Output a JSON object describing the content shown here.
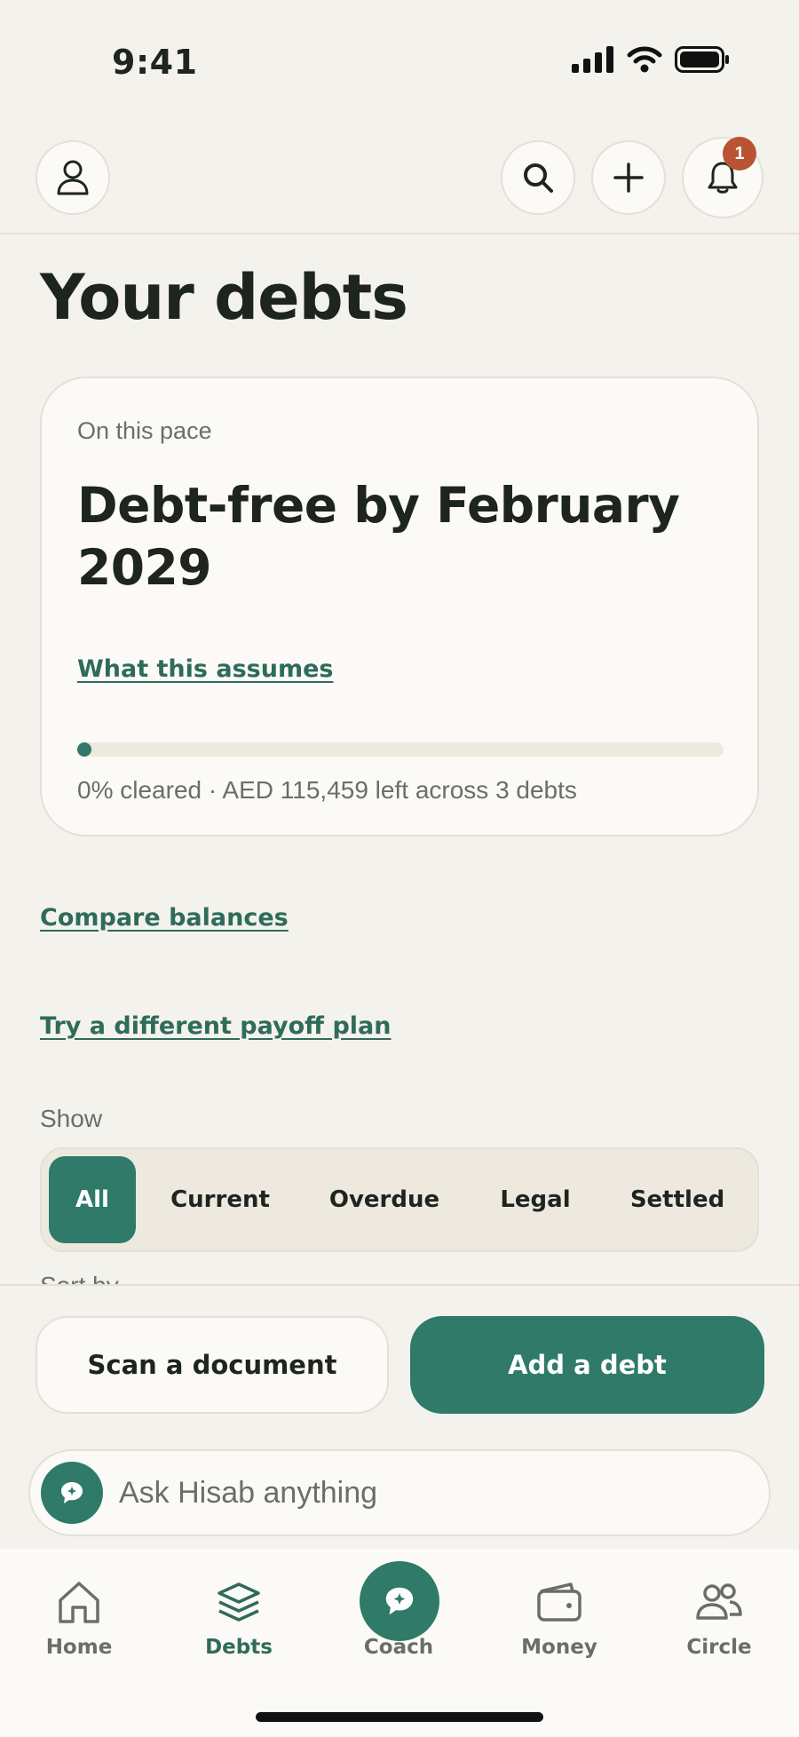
{
  "status": {
    "time": "9:41"
  },
  "header": {
    "notifications_count": "1",
    "icons": [
      "profile-icon",
      "search-icon",
      "plus-icon",
      "bell-icon"
    ]
  },
  "page": {
    "title": "Your debts"
  },
  "pace_card": {
    "eyebrow": "On this pace",
    "headline": "Debt-free by February 2029",
    "assumes_link": "What this assumes",
    "progress_fraction": 0.0,
    "caption": "0% cleared · AED 115,459 left across 3 debts"
  },
  "links": {
    "compare": "Compare balances",
    "payoff_plan": "Try a different payoff plan"
  },
  "filter": {
    "label": "Show",
    "selected": "All",
    "options": [
      "All",
      "Current",
      "Overdue",
      "Legal",
      "Settled"
    ]
  },
  "sort_peek": "Sort by",
  "actions": {
    "scan": "Scan a document",
    "add": "Add a debt"
  },
  "ask": {
    "placeholder": "Ask Hisab anything"
  },
  "tabs": [
    {
      "label": "Home",
      "icon": "home-icon"
    },
    {
      "label": "Debts",
      "icon": "layers-icon",
      "active": true
    },
    {
      "label": "Coach",
      "icon": "chat-icon"
    },
    {
      "label": "Money",
      "icon": "wallet-icon"
    },
    {
      "label": "Circle",
      "icon": "people-icon"
    }
  ],
  "colors": {
    "background": "#F4F2EC",
    "accent": "#2F7A69",
    "link": "#2F6B5A",
    "badge": "#B85432",
    "text": "#1E2420",
    "muted": "#6B6E68"
  }
}
